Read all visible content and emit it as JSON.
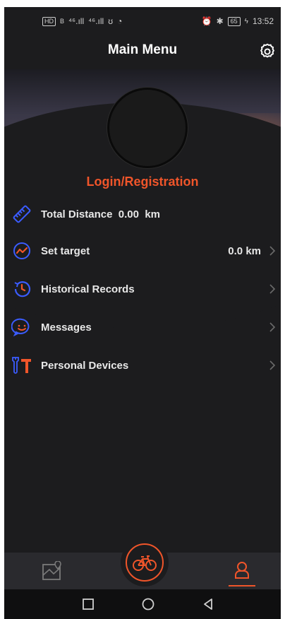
{
  "status_bar": {
    "left_badge": "HD",
    "left_b": "B",
    "signal1": "⁴⁶.ıll",
    "signal2": "⁴⁶.ıll",
    "battery": "65",
    "time": "13:52"
  },
  "header": {
    "title": "Main Menu"
  },
  "profile": {
    "login_label": "Login/Registration"
  },
  "menu": {
    "total_distance": {
      "label": "Total Distance",
      "value": "0.00",
      "unit": "km"
    },
    "set_target": {
      "label": "Set target",
      "value": "0.0 km"
    },
    "historical_records": {
      "label": "Historical Records"
    },
    "messages": {
      "label": "Messages"
    },
    "personal_devices": {
      "label": "Personal Devices"
    }
  },
  "colors": {
    "accent": "#f0552a",
    "icon_blue": "#3b5cff",
    "background": "#1c1c1e"
  },
  "icons": {
    "settings": "gear-icon",
    "distance": "ruler-icon",
    "target": "trend-icon",
    "history": "clock-history-icon",
    "messages": "smile-chat-icon",
    "devices": "tools-icon",
    "nav_map": "map-pin-icon",
    "nav_ride": "bicycle-icon",
    "nav_profile": "person-icon"
  }
}
